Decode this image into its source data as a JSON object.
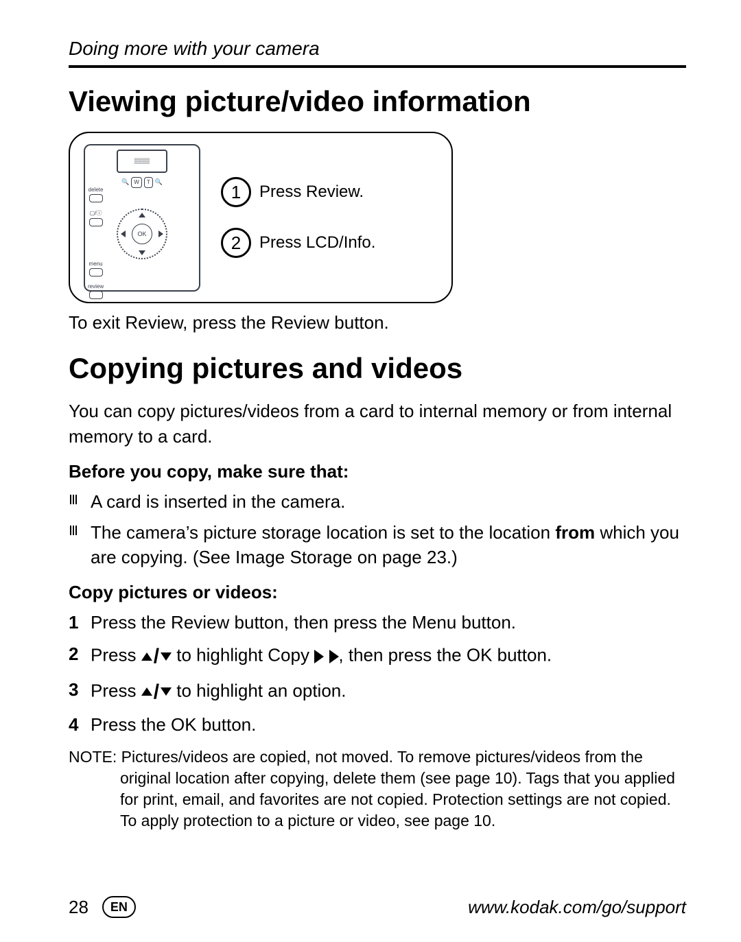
{
  "header": {
    "chapter_title": "Doing more with your camera"
  },
  "section1": {
    "title": "Viewing picture/video information",
    "diagram": {
      "camera_labels": {
        "delete": "delete",
        "lcd_info": "▢/ⓘ",
        "menu": "menu",
        "review": "review",
        "ok": "OK",
        "zoom_left": "W",
        "zoom_right": "T"
      },
      "steps": [
        {
          "num": "1",
          "text": "Press Review."
        },
        {
          "num": "2",
          "text": "Press LCD/Info."
        }
      ]
    },
    "exit_text": "To exit Review, press the Review button."
  },
  "section2": {
    "title": "Copying pictures and videos",
    "intro": "You can copy pictures/videos from a card to internal memory or from internal memory to a card.",
    "before_head": "Before you copy, make sure that:",
    "before_items": [
      {
        "text": "A card is inserted in the camera."
      },
      {
        "pre": "The camera’s picture storage location is set to the location ",
        "bold": "from",
        "post": " which you are copying. (See Image Storage on page 23.)"
      }
    ],
    "copy_head": "Copy pictures or videos:",
    "copy_steps": {
      "s1": "Press the Review button, then press the Menu button.",
      "s2_pre": "Press ",
      "s2_mid": " to highlight Copy ",
      "s2_post": " , then press the OK button.",
      "s3_pre": "Press ",
      "s3_post": " to highlight an option.",
      "s4": "Press the OK button."
    },
    "note_label": "NOTE:  ",
    "note_text": "Pictures/videos are copied, not moved. To remove pictures/videos from the original location after copying, delete them (see page 10). Tags that you applied for print, email, and favorites are not copied. Protection settings are not copied. To apply protection to a picture or video, see page 10."
  },
  "footer": {
    "page": "28",
    "lang": "EN",
    "url": "www.kodak.com/go/support"
  }
}
